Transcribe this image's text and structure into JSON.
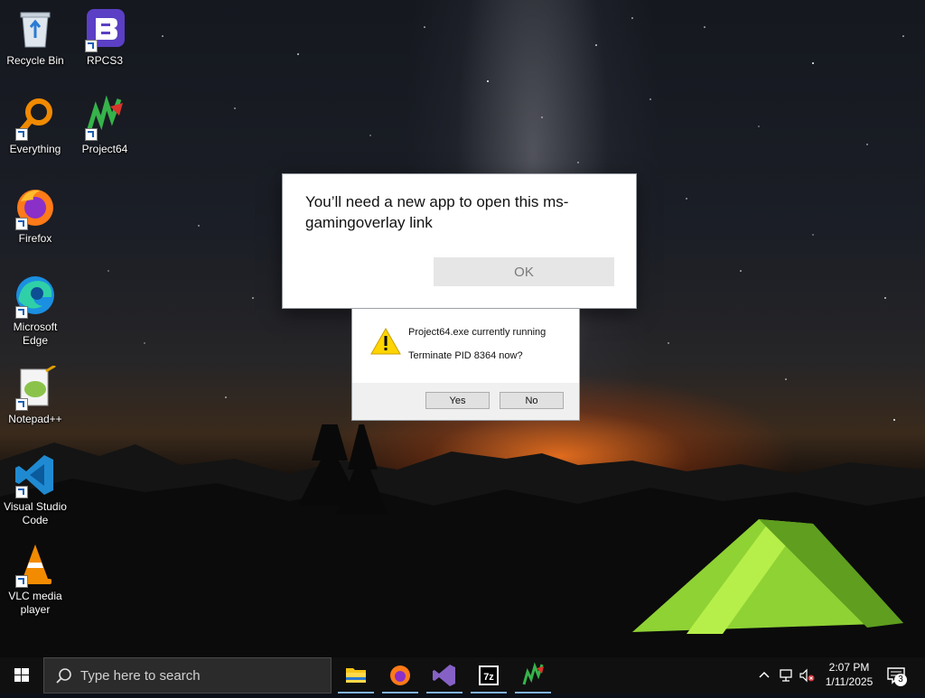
{
  "desktop": {
    "icons": [
      {
        "label": "Recycle Bin",
        "icon": "recycle-bin-icon"
      },
      {
        "label": "RPCS3",
        "icon": "rpcs3-icon"
      },
      {
        "label": "Everything",
        "icon": "everything-search-icon"
      },
      {
        "label": "Project64",
        "icon": "project64-icon"
      },
      {
        "label": "Firefox",
        "icon": "firefox-icon"
      },
      {
        "label": "Microsoft Edge",
        "icon": "edge-icon"
      },
      {
        "label": "Notepad++",
        "icon": "notepadpp-icon"
      },
      {
        "label": "Visual Studio Code",
        "icon": "vscode-icon"
      },
      {
        "label": "VLC media player",
        "icon": "vlc-icon"
      }
    ]
  },
  "dialog_app": {
    "message": "You’ll need a new app to open this ms-gamingoverlay link",
    "ok_label": "OK"
  },
  "dialog_kill": {
    "line1": "Project64.exe currently running",
    "line2": "Terminate PID 8364 now?",
    "yes_label": "Yes",
    "no_label": "No"
  },
  "taskbar": {
    "search_placeholder": "Type here to search",
    "apps": [
      "file-explorer-icon",
      "firefox-icon",
      "visual-studio-icon",
      "7zip-icon",
      "project64-icon"
    ],
    "time": "2:07 PM",
    "date": "1/11/2025",
    "notification_count": "3"
  }
}
